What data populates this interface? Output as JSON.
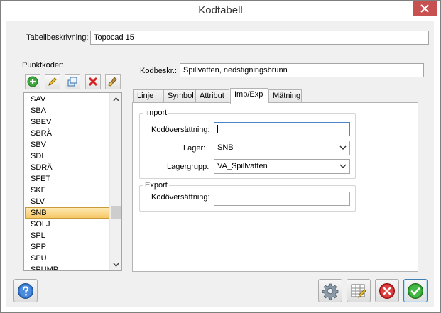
{
  "window": {
    "title": "Kodtabell",
    "close_glyph": "✕"
  },
  "table_description": {
    "label": "Tabellbeskrivning:",
    "value": "Topocad 15"
  },
  "point_codes": {
    "label": "Punktkoder:",
    "toolbar": [
      "add-icon",
      "edit-pencil-icon",
      "copy-icon",
      "delete-icon",
      "clear-brush-icon"
    ],
    "items": [
      "SAV",
      "SBA",
      "SBEV",
      "SBRÄ",
      "SBV",
      "SDI",
      "SDRÄ",
      "SFET",
      "SKF",
      "SLV",
      "SNB",
      "SOLJ",
      "SPL",
      "SPP",
      "SPU",
      "SPUMP"
    ],
    "selected": "SNB"
  },
  "code_description": {
    "label": "Kodbeskr.:",
    "value": "Spillvatten, nedstigningsbrunn"
  },
  "tabs": {
    "items": [
      "Linje",
      "Symbol",
      "Attribut",
      "Imp/Exp",
      "Mätning"
    ],
    "active": "Imp/Exp"
  },
  "import_group": {
    "title": "Import",
    "code_translation_label": "Kodöversättning:",
    "code_translation_value": "",
    "layer_label": "Lager:",
    "layer_value": "SNB",
    "layer_group_label": "Lagergrupp:",
    "layer_group_value": "VA_Spillvatten"
  },
  "export_group": {
    "title": "Export",
    "code_translation_label": "Kodöversättning:",
    "code_translation_value": ""
  },
  "bottom_buttons": [
    "help-icon",
    "settings-gear-icon",
    "table-edit-icon",
    "cancel-icon",
    "ok-icon"
  ]
}
